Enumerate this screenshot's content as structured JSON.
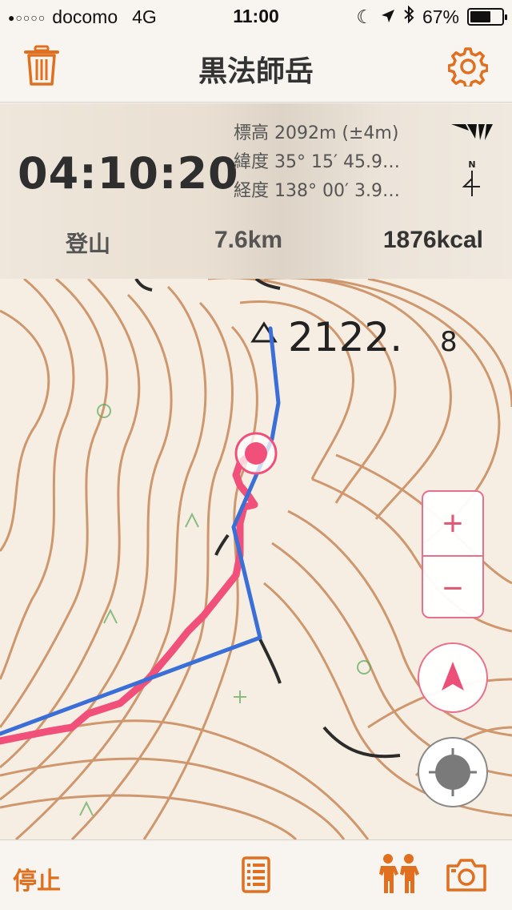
{
  "status_bar": {
    "carrier": "docomo",
    "network": "4G",
    "time": "11:00",
    "battery": "67%",
    "signal_dots": "●○○○○"
  },
  "header": {
    "title": "黒法師岳"
  },
  "tracker": {
    "elapsed": "04:10:20",
    "altitude": "標高 2092m (±4m)",
    "latitude": "緯度 35° 15′ 45.9…",
    "longitude": "経度 138° 00′ 3.9…",
    "compass_label": "N",
    "mode": "登山",
    "distance": "7.6km",
    "calories": "1876kcal"
  },
  "map": {
    "peak_label": "△2122.8",
    "zoom_in": "+",
    "zoom_out": "−"
  },
  "toolbar": {
    "stop_label": "停止"
  },
  "colors": {
    "accent": "#e07020",
    "track_pink": "#f0507a",
    "route_blue": "#3a6fd8",
    "contour": "#c9885a"
  }
}
